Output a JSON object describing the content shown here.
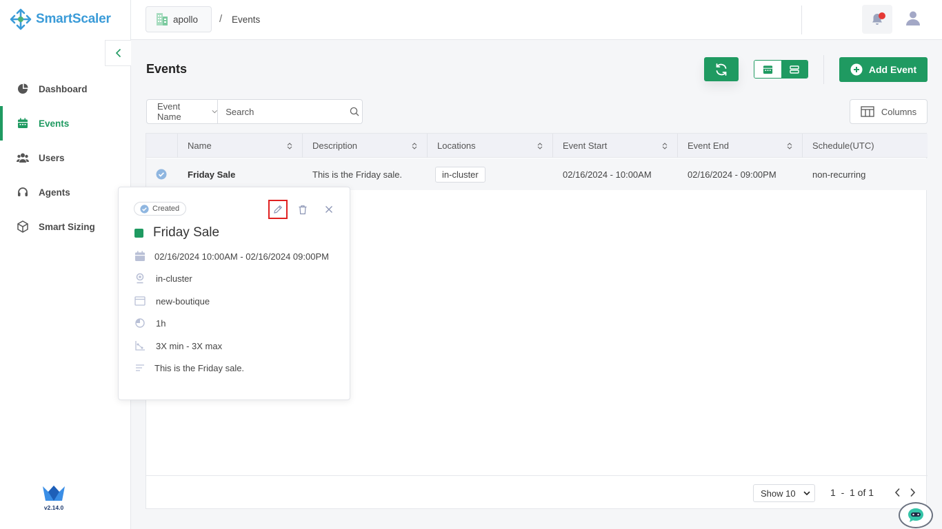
{
  "app": {
    "name": "SmartScaler",
    "version": "v2.14.0"
  },
  "sidebar": {
    "items": [
      {
        "label": "Dashboard",
        "icon": "pie-chart-icon"
      },
      {
        "label": "Events",
        "icon": "calendar-icon",
        "active": true
      },
      {
        "label": "Users",
        "icon": "users-icon"
      },
      {
        "label": "Agents",
        "icon": "headset-icon"
      },
      {
        "label": "Smart Sizing",
        "icon": "cube-icon"
      }
    ]
  },
  "header": {
    "project": "apollo",
    "separator": "/",
    "page": "Events"
  },
  "toolbar": {
    "title": "Events",
    "add_label": "Add Event"
  },
  "search": {
    "filter_label": "Event Name",
    "placeholder": "Search",
    "columns_label": "Columns"
  },
  "table": {
    "headers": [
      "Name",
      "Description",
      "Locations",
      "Event Start",
      "Event End",
      "Schedule(UTC)"
    ],
    "rows": [
      {
        "name": "Friday Sale",
        "description": "This is the Friday sale.",
        "location": "in-cluster",
        "start": "02/16/2024 - 10:00AM",
        "end": "02/16/2024 - 09:00PM",
        "schedule": "non-recurring"
      }
    ],
    "footer": {
      "show": "Show 10",
      "range": "1  -  1 of 1"
    }
  },
  "popup": {
    "status": "Created",
    "title": "Friday Sale",
    "datetime": "02/16/2024 10:00AM - 02/16/2024 09:00PM",
    "location": "in-cluster",
    "app": "new-boutique",
    "duration": "1h",
    "scaling": "3X min - 3X max",
    "description": "This is the Friday sale."
  },
  "colors": {
    "brand": "#1f9a61",
    "logo": "#3a9bd8",
    "alert": "#e53935"
  }
}
